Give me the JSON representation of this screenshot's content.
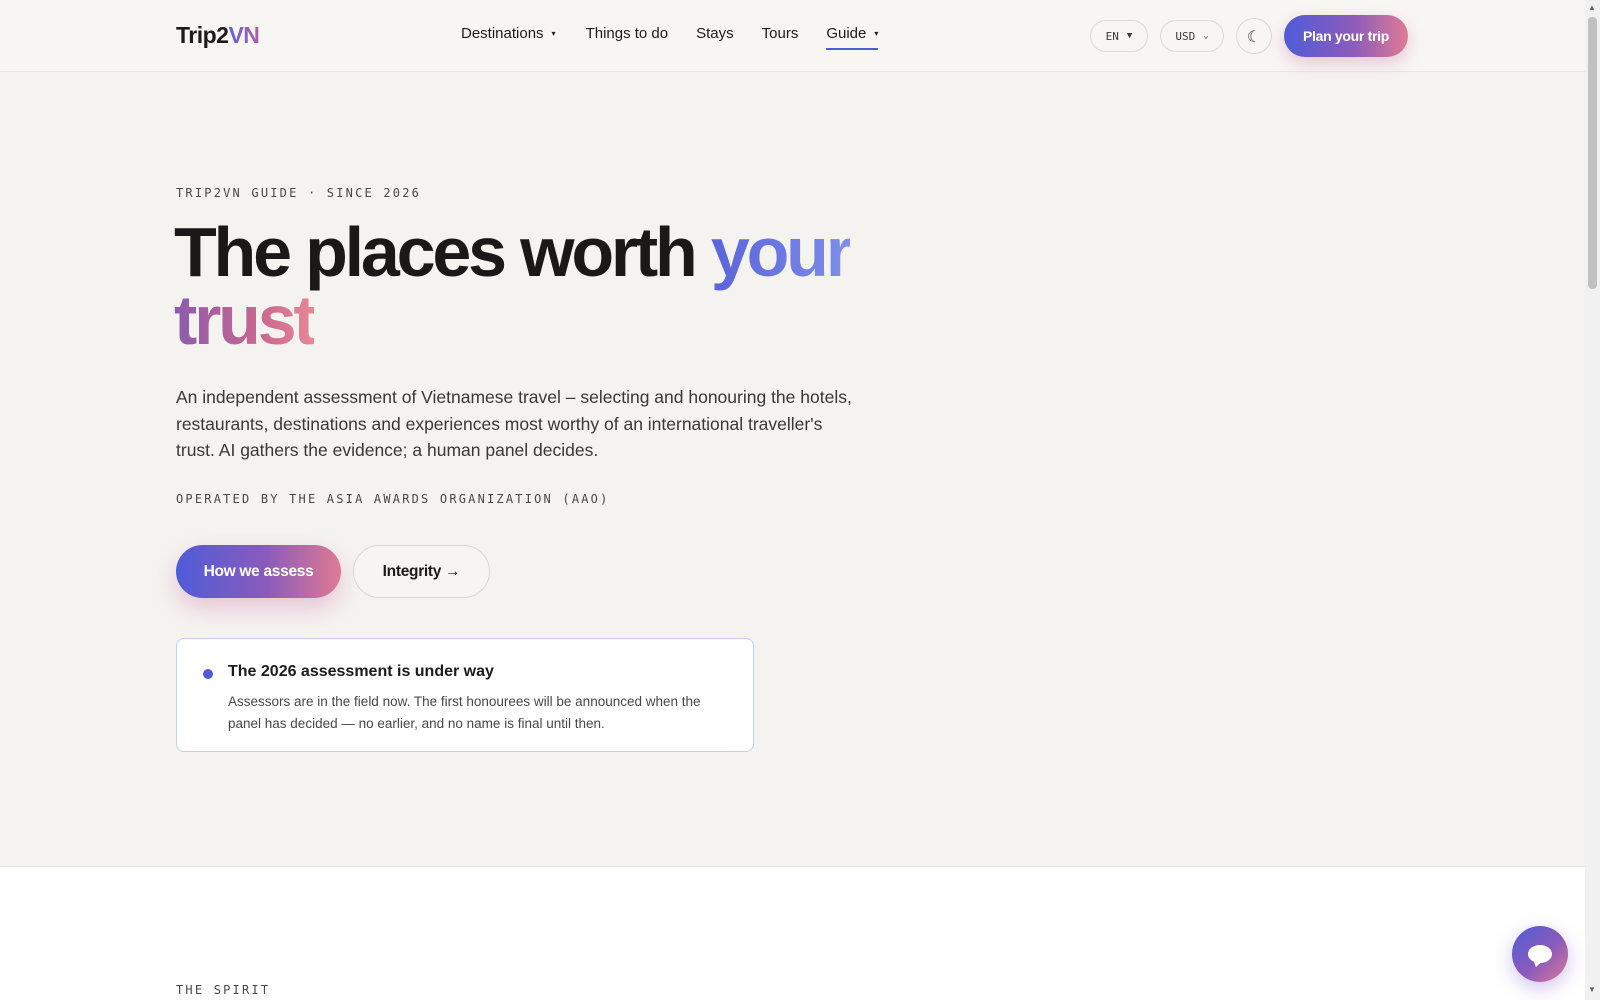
{
  "header": {
    "logo_main": "Trip2",
    "logo_accent": "VN",
    "nav": [
      {
        "label": "Destinations",
        "caret": "▾"
      },
      {
        "label": "Things to do"
      },
      {
        "label": "Stays"
      },
      {
        "label": "Tours"
      },
      {
        "label": "Guide",
        "caret": "▾",
        "active": true
      }
    ],
    "language": {
      "value": "EN",
      "chevron": "▼"
    },
    "currency": {
      "value": "USD",
      "chevron": "⌄"
    },
    "theme_toggle_icon": "☾",
    "plan_button": "Plan your trip"
  },
  "hero": {
    "eyebrow": "TRIP2VN GUIDE · SINCE 2026",
    "headline_part1": "The places worth ",
    "headline_accent1": "your",
    "headline_accent2": "trust",
    "lede": "An independent assessment of Vietnamese travel – selecting and honouring the hotels, restaurants, destinations and experiences most worthy of an international traveller's trust. AI gathers the evidence; a human panel decides.",
    "operated_by": "OPERATED BY THE ASIA AWARDS ORGANIZATION (AAO)",
    "primary_button": "How we assess",
    "secondary_button": "Integrity →"
  },
  "status_card": {
    "title": "The 2026 assessment is under way",
    "body": "Assessors are in the field now. The first honourees will be announced when the panel has decided — no earlier, and no name is final until then."
  },
  "section2": {
    "eyebrow": "THE SPIRIT"
  },
  "chat": {
    "icon": "chat-bubble-icon"
  },
  "colors": {
    "accent": "#4f5cd6",
    "gradient_start": "#4f5cd8",
    "gradient_mid": "#8a5bbb",
    "gradient_end": "#e07a93",
    "background": "#f5f3f0"
  }
}
